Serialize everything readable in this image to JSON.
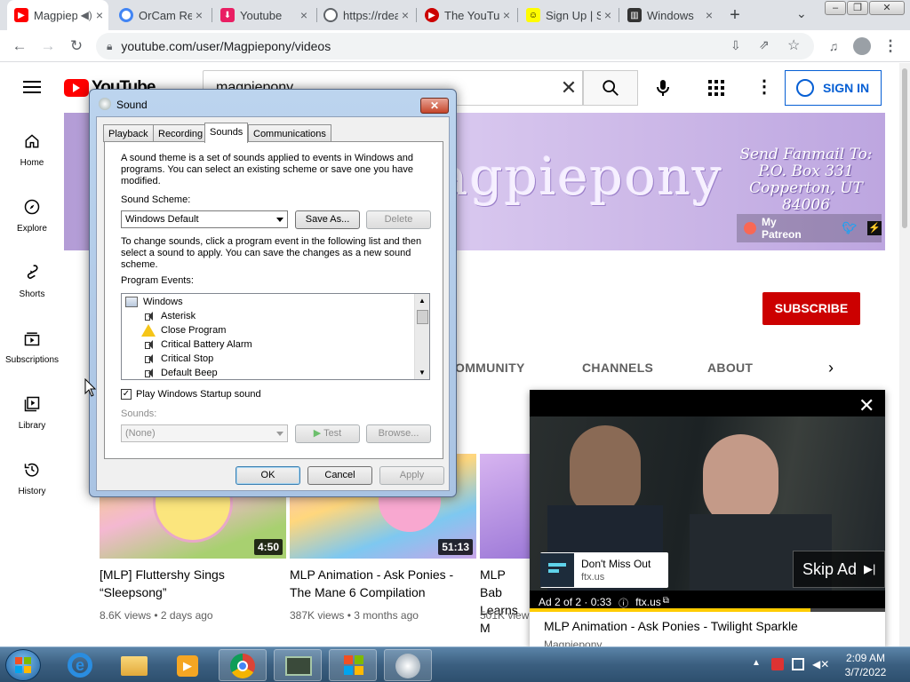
{
  "browser": {
    "tabs": [
      {
        "title": "Magpiepony",
        "favicon": "youtube-icon",
        "color": "#ff0000"
      },
      {
        "title": "OrCam Read",
        "favicon": "orcam-icon",
        "color": "#4285f4"
      },
      {
        "title": "Youtube",
        "favicon": "bookmark-icon",
        "color": "#e91e63"
      },
      {
        "title": "https://rdeals",
        "favicon": "globe-icon",
        "color": "#5f6368"
      },
      {
        "title": "The YouTube",
        "favicon": "youtube-icon",
        "color": "#cc0000"
      },
      {
        "title": "Sign Up | Snapchat",
        "favicon": "snapchat-icon",
        "color": "#fffc00"
      },
      {
        "title": "Windows",
        "favicon": "windows-icon",
        "color": "#333333"
      }
    ],
    "tab_close": "×",
    "new_tab": "+",
    "url": "youtube.com/user/Magpiepony/videos"
  },
  "youtube": {
    "logo_text": "YouTube",
    "search_value": "magpiepony",
    "sign_in": "SIGN IN",
    "sidebar": [
      {
        "label": "Home",
        "icon": "home-icon"
      },
      {
        "label": "Explore",
        "icon": "compass-icon"
      },
      {
        "label": "Shorts",
        "icon": "shorts-icon"
      },
      {
        "label": "Subscriptions",
        "icon": "subscriptions-icon"
      },
      {
        "label": "Library",
        "icon": "library-icon"
      },
      {
        "label": "History",
        "icon": "history-icon"
      }
    ],
    "banner": {
      "title": "agpiepony",
      "fanmail": "Send Fanmail To:\nP.O. Box 331\nCopperton, UT\n84006",
      "patreon": "My Patreon"
    },
    "subscribe": "SUBSCRIBE",
    "channel_tabs": [
      "OMMUNITY",
      "CHANNELS",
      "ABOUT"
    ],
    "videos": [
      {
        "title": "[MLP] Fluttershy Sings “Sleepsong”",
        "meta": "8.6K views • 2 days ago",
        "duration": "4:50"
      },
      {
        "title": "MLP Animation - Ask Ponies - The Mane 6 Compilation",
        "meta": "387K views • 3 months ago",
        "duration": "51:13"
      },
      {
        "title": "MLP Bab Learns M",
        "meta": "501K view",
        "duration": ""
      }
    ],
    "miniplayer": {
      "ad_title": "Don't Miss Out",
      "ad_domain": "ftx.us",
      "skip": "Skip Ad",
      "ad_info": "Ad 2 of 2 · 0:33",
      "ad_link": "ftx.us",
      "progress": 0.79,
      "video_title": "MLP Animation - Ask Ponies - Twilight Sparkle",
      "channel": "Magpiepony"
    }
  },
  "dialog": {
    "title": "Sound",
    "tabs": [
      "Playback",
      "Recording",
      "Sounds",
      "Communications"
    ],
    "intro": "A sound theme is a set of sounds applied to events in Windows and programs.  You can select an existing scheme or save one you have modified.",
    "scheme_label": "Sound Scheme:",
    "scheme_value": "Windows Default",
    "save_as": "Save As...",
    "delete": "Delete",
    "instructions": "To change sounds, click a program event in the following list and then select a sound to apply.  You can save the changes as a new sound scheme.",
    "events_label": "Program Events:",
    "events": [
      {
        "label": "Windows",
        "icon": "windows-group-icon",
        "indent": 0
      },
      {
        "label": "Asterisk",
        "icon": "speaker-icon",
        "indent": 1
      },
      {
        "label": "Close Program",
        "icon": "warning-icon",
        "indent": 1
      },
      {
        "label": "Critical Battery Alarm",
        "icon": "speaker-icon",
        "indent": 1
      },
      {
        "label": "Critical Stop",
        "icon": "speaker-icon",
        "indent": 1
      },
      {
        "label": "Default Beep",
        "icon": "speaker-icon",
        "indent": 1
      }
    ],
    "startup_sound": "Play Windows Startup sound",
    "startup_checked": true,
    "sounds_label": "Sounds:",
    "sounds_value": "(None)",
    "test": "Test",
    "browse": "Browse...",
    "ok": "OK",
    "cancel": "Cancel",
    "apply": "Apply"
  },
  "taskbar": {
    "time": "2:09 AM",
    "date": "3/7/2022"
  }
}
